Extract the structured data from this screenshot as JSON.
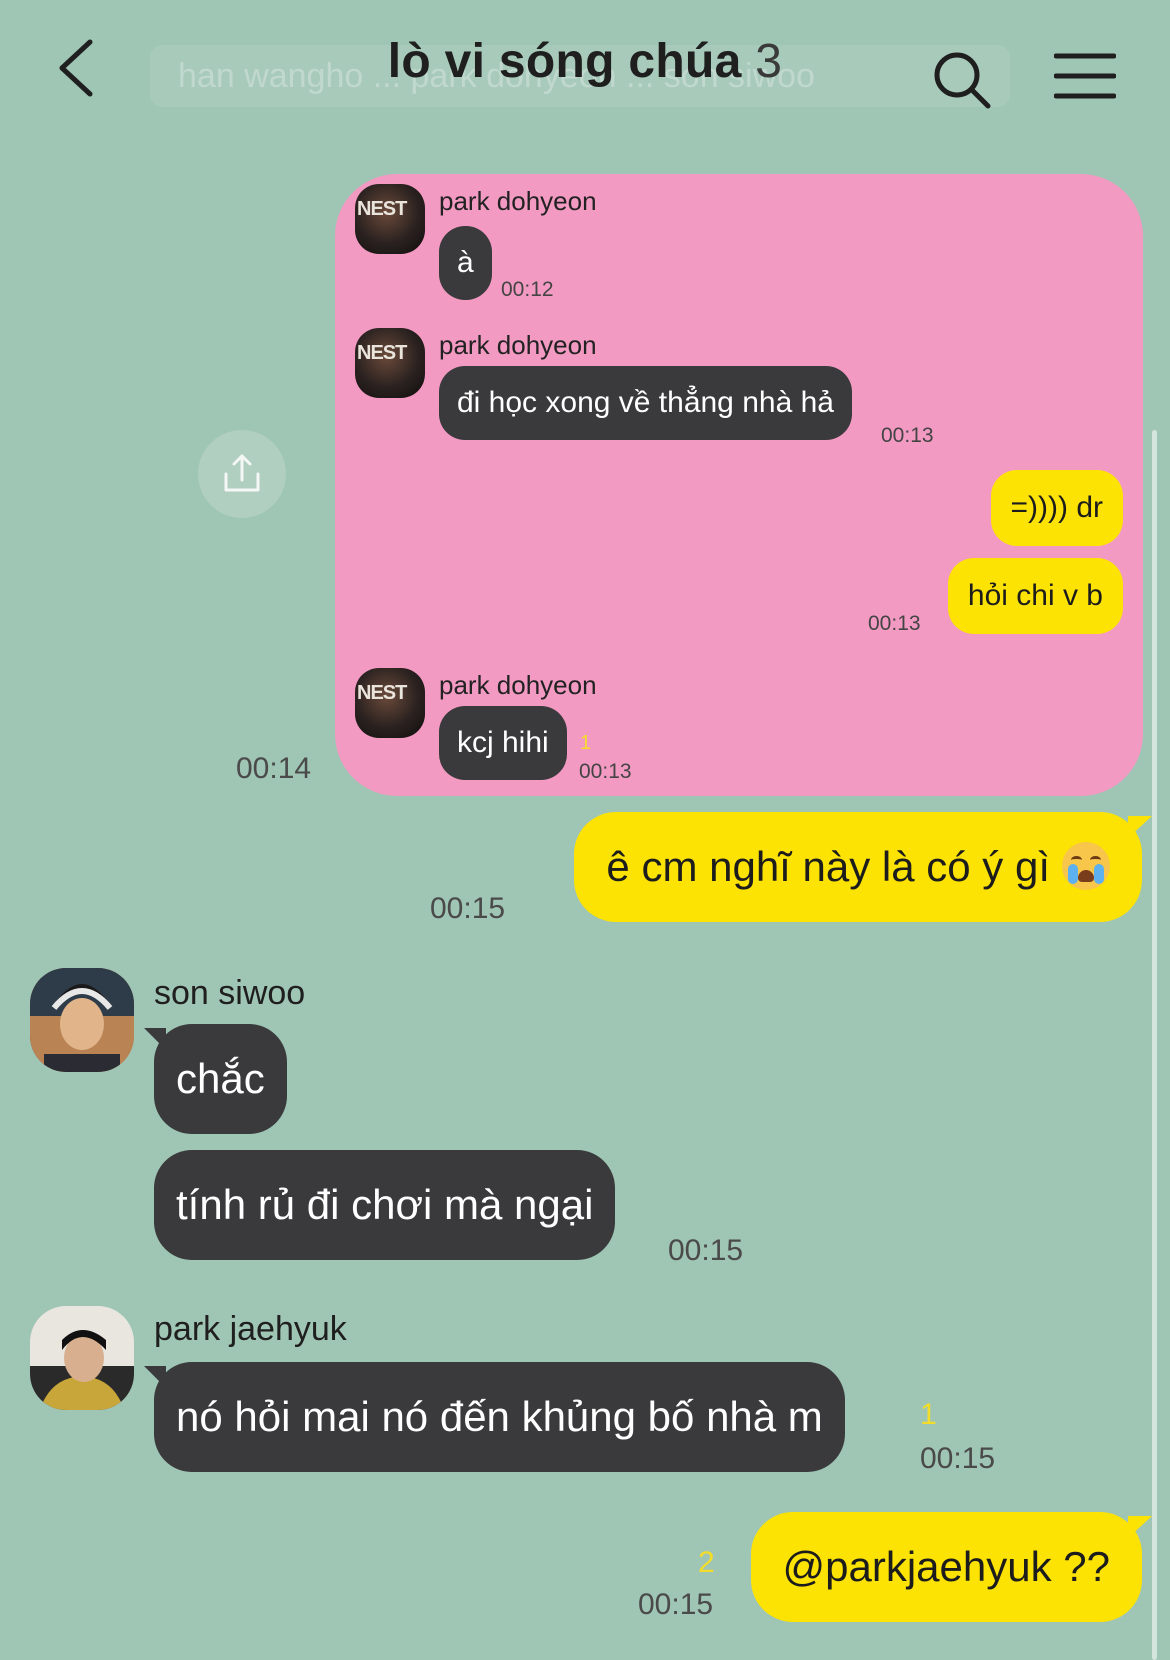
{
  "header": {
    "back_icon": "chevron-left-icon",
    "title": "lò vi sóng chúa",
    "member_count": "3",
    "background_strip_text": "han wangho ... park dohyeon ... son siwoo",
    "search_icon": "search-icon",
    "menu_icon": "hamburger-menu-icon"
  },
  "quoted_card": {
    "share_icon": "share-upload-icon",
    "card_color": "#f39ac3",
    "messages": [
      {
        "sender": "park dohyeon",
        "text": "à",
        "time": "00:12"
      },
      {
        "sender": "park dohyeon",
        "text": "đi học xong về thẳng nhà hả",
        "time": "00:13"
      },
      {
        "sender": "me",
        "text": "=)))) dr"
      },
      {
        "sender": "me",
        "text": "hỏi chi v b",
        "time": "00:13"
      },
      {
        "sender": "park dohyeon",
        "text": "kcj hihi",
        "unread": "1",
        "time": "00:13"
      }
    ],
    "shared_time": "00:14"
  },
  "chat": {
    "messages": [
      {
        "sender": "me",
        "text": "ê cm nghĩ này là có ý gì",
        "emoji": "crying-face-emoji",
        "time": "00:15"
      },
      {
        "sender": "son siwoo",
        "lines": [
          "chắc",
          "tính rủ đi chơi mà ngại"
        ],
        "time": "00:15"
      },
      {
        "sender": "park jaehyuk",
        "text": "nó hỏi mai nó đến khủng bố nhà m",
        "unread": "1",
        "time": "00:15"
      },
      {
        "sender": "me",
        "text": "@parkjaehyuk ??",
        "unread": "2",
        "time": "00:15"
      }
    ]
  },
  "colors": {
    "background": "#9fc5b4",
    "my_bubble": "#fce303",
    "their_bubble": "#3a3a3c",
    "unread_count": "#f4dd2a"
  }
}
